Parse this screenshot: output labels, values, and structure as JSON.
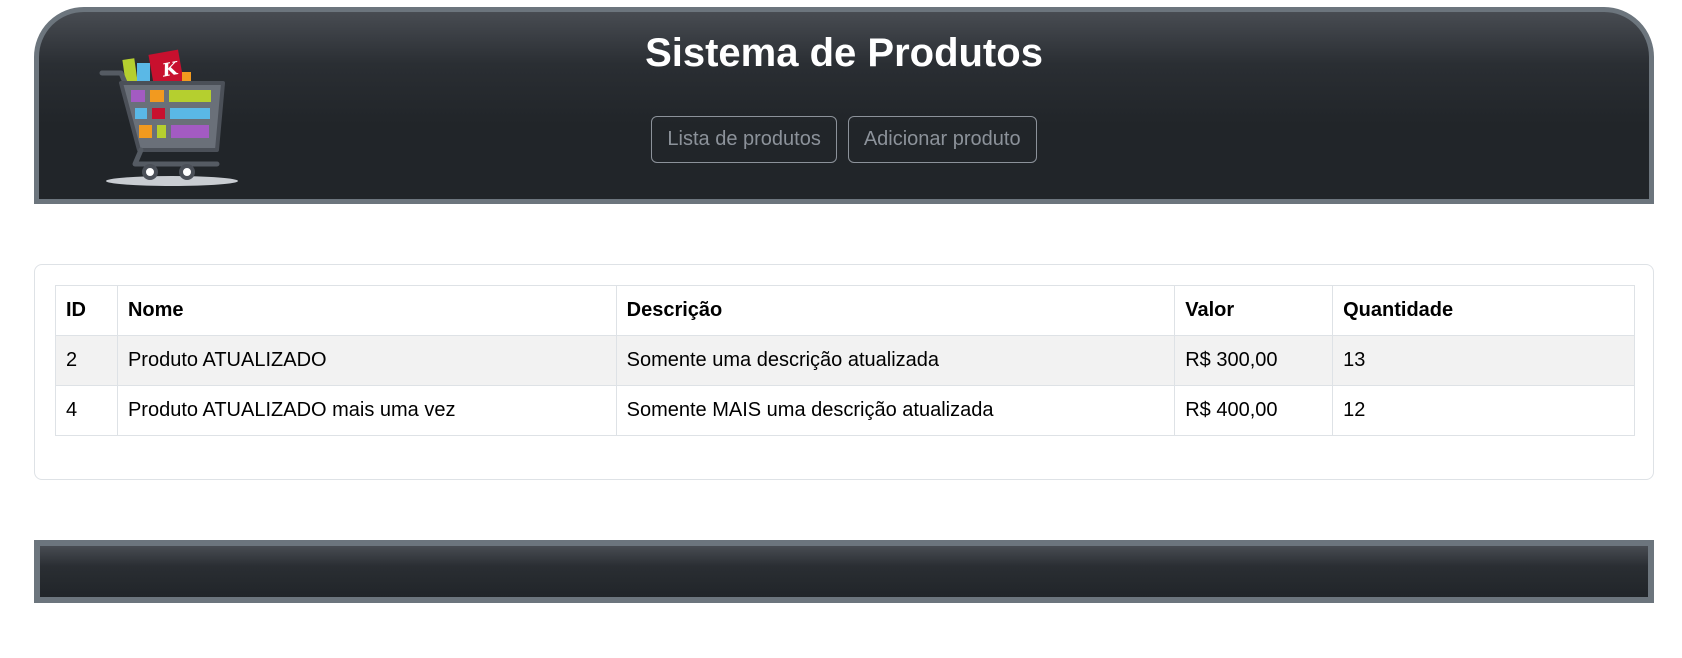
{
  "header": {
    "title": "Sistema de Produtos",
    "logo_icon": "shopping-cart-icon",
    "nav": [
      {
        "label": "Lista de produtos"
      },
      {
        "label": "Adicionar produto"
      }
    ]
  },
  "table": {
    "columns": [
      "ID",
      "Nome",
      "Descrição",
      "Valor",
      "Quantidade"
    ],
    "rows": [
      {
        "id": "2",
        "nome": "Produto ATUALIZADO",
        "descricao": "Somente uma descrição atualizada",
        "valor": "R$ 300,00",
        "quantidade": "13"
      },
      {
        "id": "4",
        "nome": "Produto ATUALIZADO mais uma vez",
        "descricao": "Somente MAIS uma descrição atualizada",
        "valor": "R$ 400,00",
        "quantidade": "12"
      }
    ]
  },
  "colors": {
    "header_bg": "#212529",
    "header_border": "#6c757d",
    "nav_border": "#8c929a",
    "row_stripe": "#f2f2f2",
    "cell_border": "#dee2e6"
  }
}
